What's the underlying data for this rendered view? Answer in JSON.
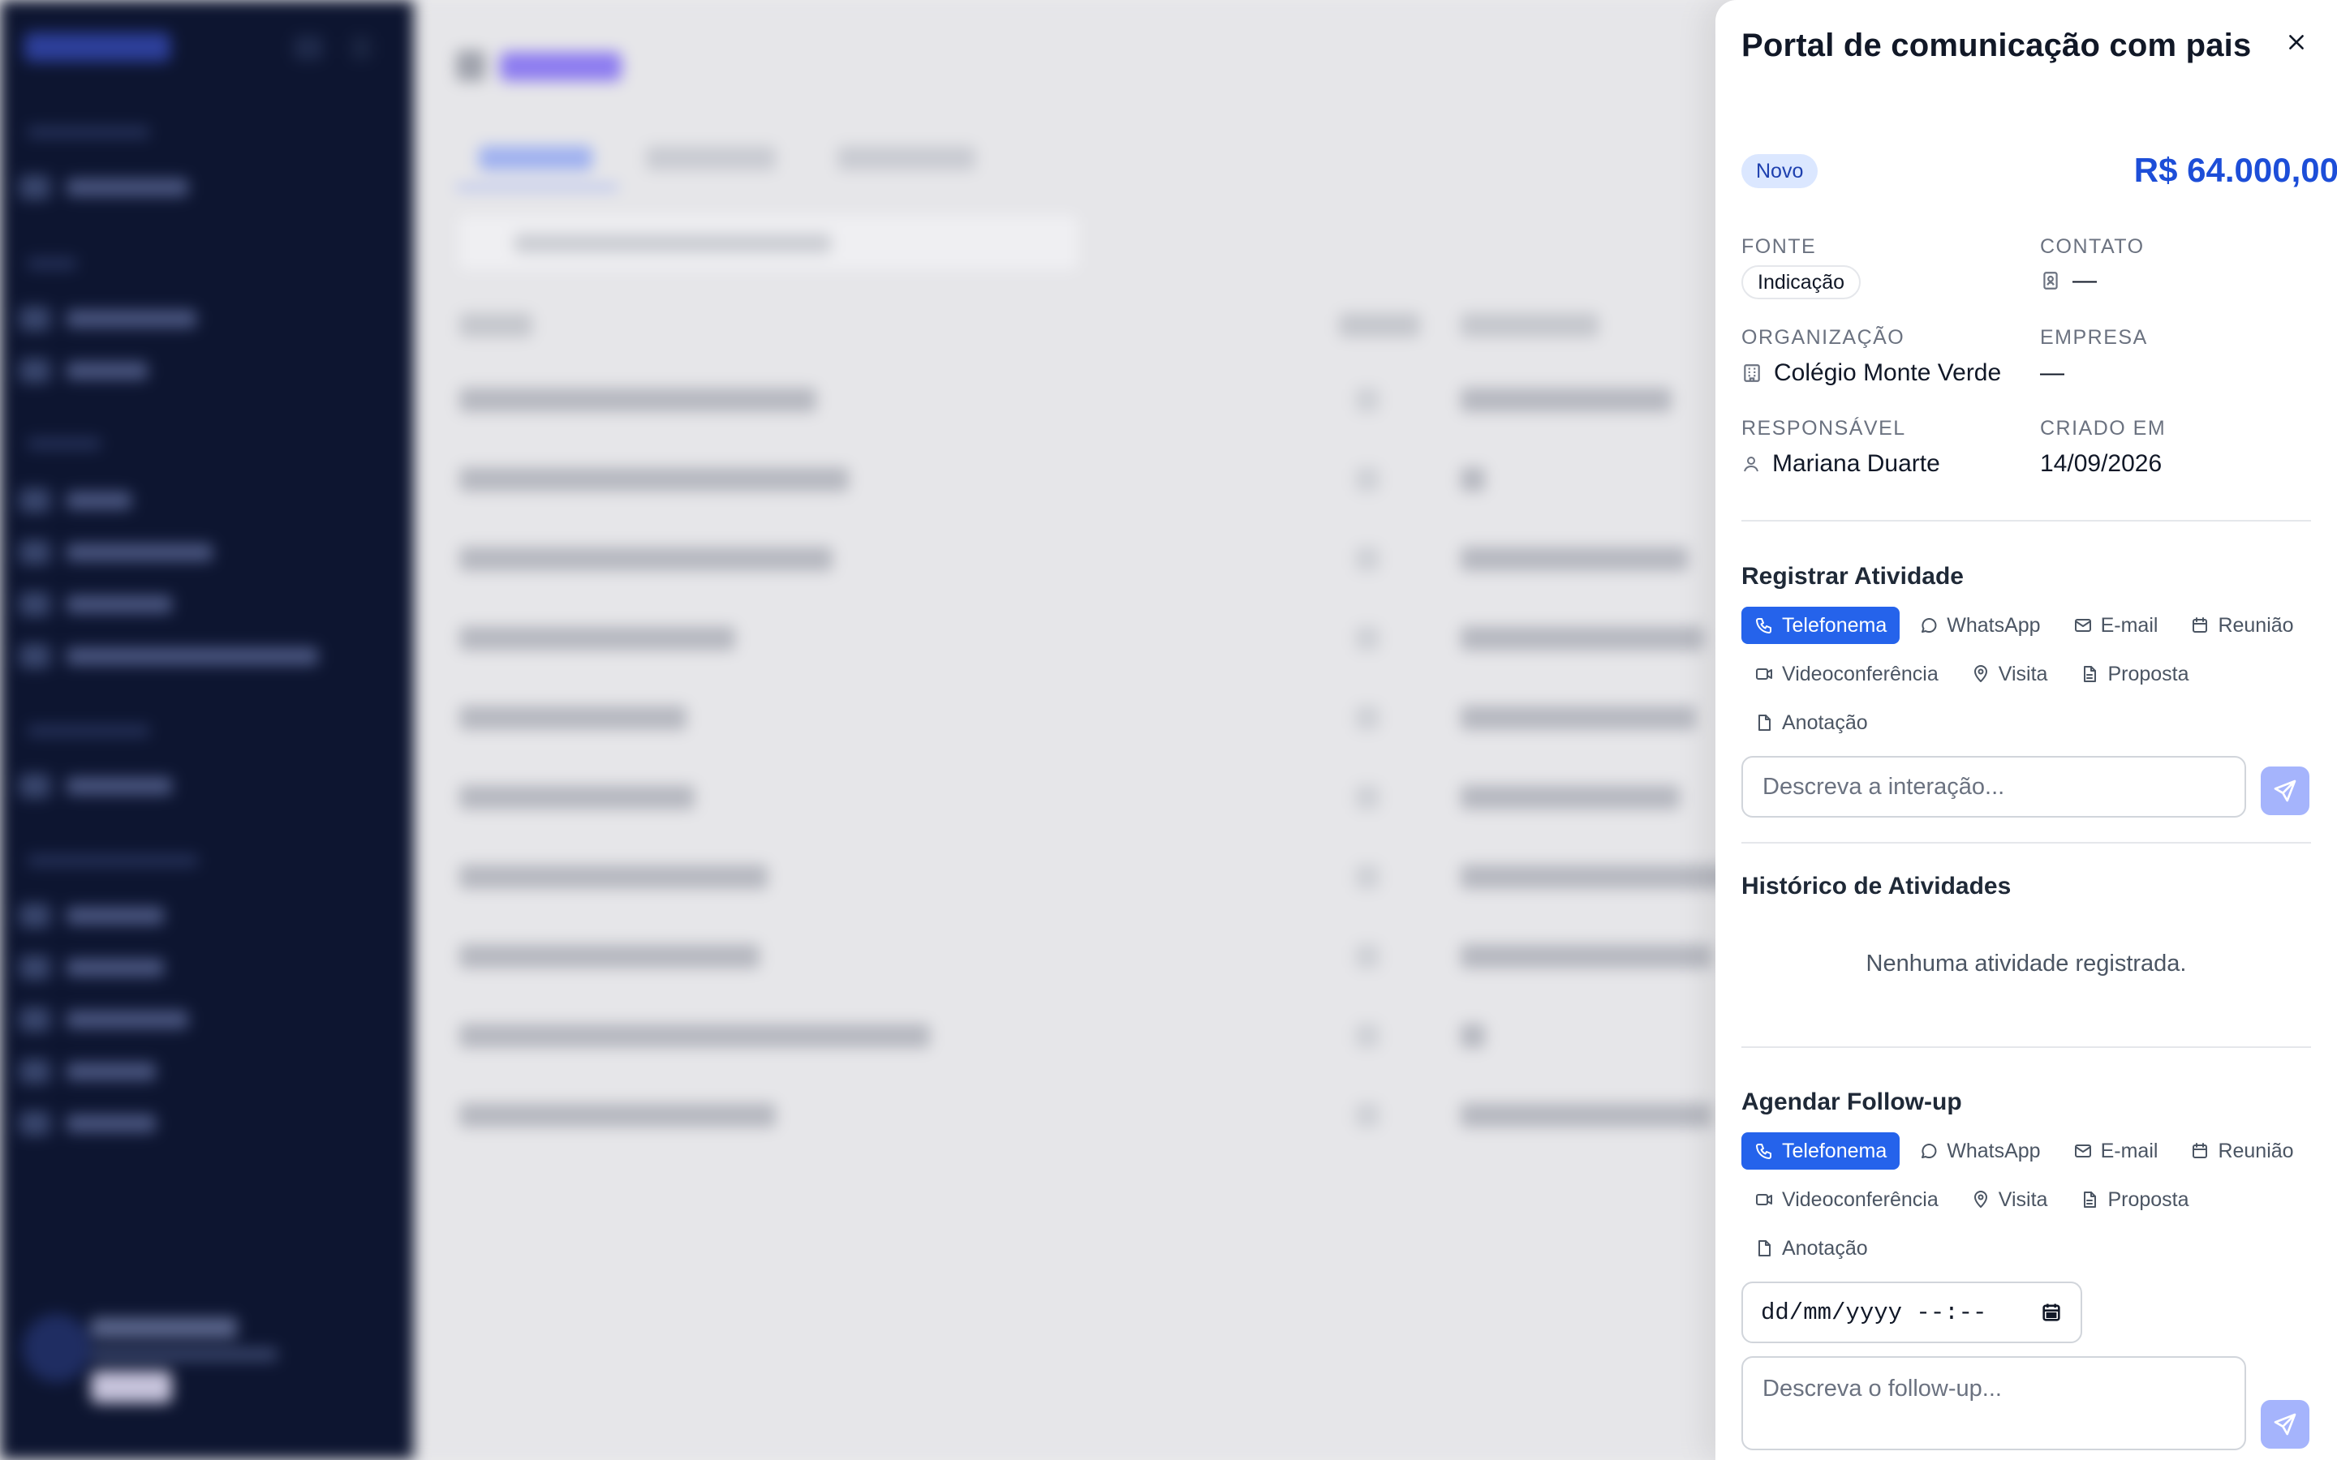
{
  "drawer": {
    "title": "Portal de comunicação com pais",
    "status": "Novo",
    "amount": "R$ 64.000,00",
    "fields": {
      "fonte": {
        "label": "Fonte",
        "value": "Indicação"
      },
      "contato": {
        "label": "Contato",
        "value": "—"
      },
      "organizacao": {
        "label": "Organização",
        "value": "Colégio Monte Verde"
      },
      "empresa": {
        "label": "Empresa",
        "value": "—"
      },
      "responsavel": {
        "label": "Responsável",
        "value": "Mariana Duarte"
      },
      "criado_em": {
        "label": "Criado em",
        "value": "14/09/2026"
      }
    },
    "register_activity": {
      "title": "Registrar Atividade",
      "types": [
        "Telefonema",
        "WhatsApp",
        "E-mail",
        "Reunião",
        "Videoconferência",
        "Visita",
        "Proposta",
        "Anotação"
      ],
      "selected": "Telefonema",
      "placeholder": "Descreva a interação..."
    },
    "history": {
      "title": "Histórico de Atividades",
      "empty": "Nenhuma atividade registrada."
    },
    "followup": {
      "title": "Agendar Follow-up",
      "types": [
        "Telefonema",
        "WhatsApp",
        "E-mail",
        "Reunião",
        "Videoconferência",
        "Visita",
        "Proposta",
        "Anotação"
      ],
      "selected": "Telefonema",
      "date_placeholder": "dd/mm/yyyy --:--",
      "placeholder": "Descreva o follow-up..."
    }
  },
  "colors": {
    "primary": "#2563eb",
    "amount": "#1d4ed8",
    "badge_bg": "#dbe7ff",
    "send_bg": "#a5b4fc",
    "sidebar_bg": "#0d1530"
  }
}
